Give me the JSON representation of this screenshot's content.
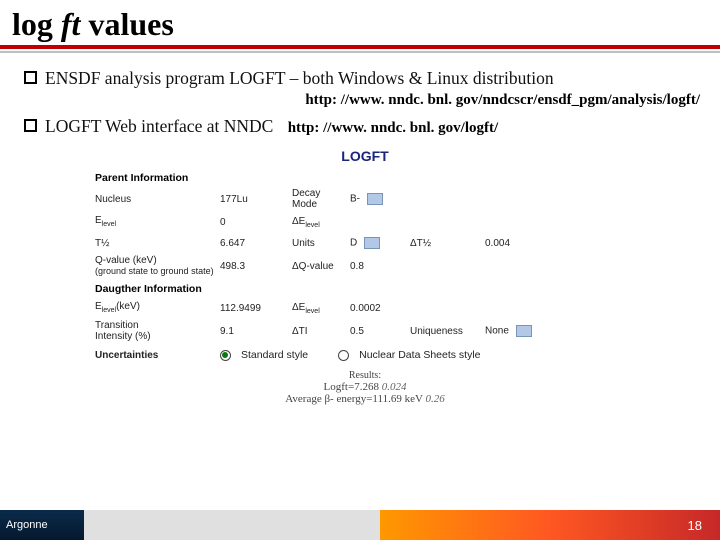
{
  "title": {
    "pre": "log ",
    "it": "ft",
    "post": " values"
  },
  "bullets": {
    "b1": "ENSDF analysis program LOGFT – both Windows & Linux distribution",
    "url1": "http: //www. nndc. bnl. gov/nndcscr/ensdf_pgm/analysis/logft/",
    "b2": "LOGFT Web interface at NNDC",
    "url2": "http: //www. nndc. bnl. gov/logft/"
  },
  "form": {
    "app_title": "LOGFT",
    "sec_parent": "Parent Information",
    "sec_daughter": "Daugther Information",
    "sec_unc": "Uncertainties",
    "rows": {
      "nucleus": {
        "l": "Nucleus",
        "v": "177Lu",
        "l2": "Decay\nMode",
        "v2": "B-"
      },
      "elevel_p": {
        "l": "Elevel",
        "v": "0",
        "l2": "ΔElevel",
        "v2": ""
      },
      "thalf": {
        "l": "T½",
        "v": "6.647",
        "l2": "Units",
        "v2": "D",
        "l3": "ΔT½",
        "v3": "0.004"
      },
      "qvalue": {
        "l": "Q-value (keV)\n(ground state to ground state)",
        "v": "498.3",
        "l2": "ΔQ-value",
        "v2": "0.8"
      },
      "elevel_d": {
        "l": "Elevel(keV)",
        "v": "112.9499",
        "l2": "ΔElevel",
        "v2": "0.0002"
      },
      "ti": {
        "l": "Transition\nIntensity (%)",
        "v": "9.1",
        "l2": "ΔTI",
        "v2": "0.5",
        "l3": "Uniqueness",
        "v3": "None"
      }
    },
    "radios": {
      "standard": "Standard style",
      "nds": "Nuclear Data Sheets style"
    },
    "results": {
      "head": "Results:",
      "logft_lbl": "Logft=",
      "logft_val": "7.268",
      "logft_unc": "0.024",
      "beta_lbl": "Average β- energy=",
      "beta_val": "111.69 keV",
      "beta_unc": "0.26"
    }
  },
  "footer": {
    "logo": "Argonne",
    "page": "18"
  }
}
